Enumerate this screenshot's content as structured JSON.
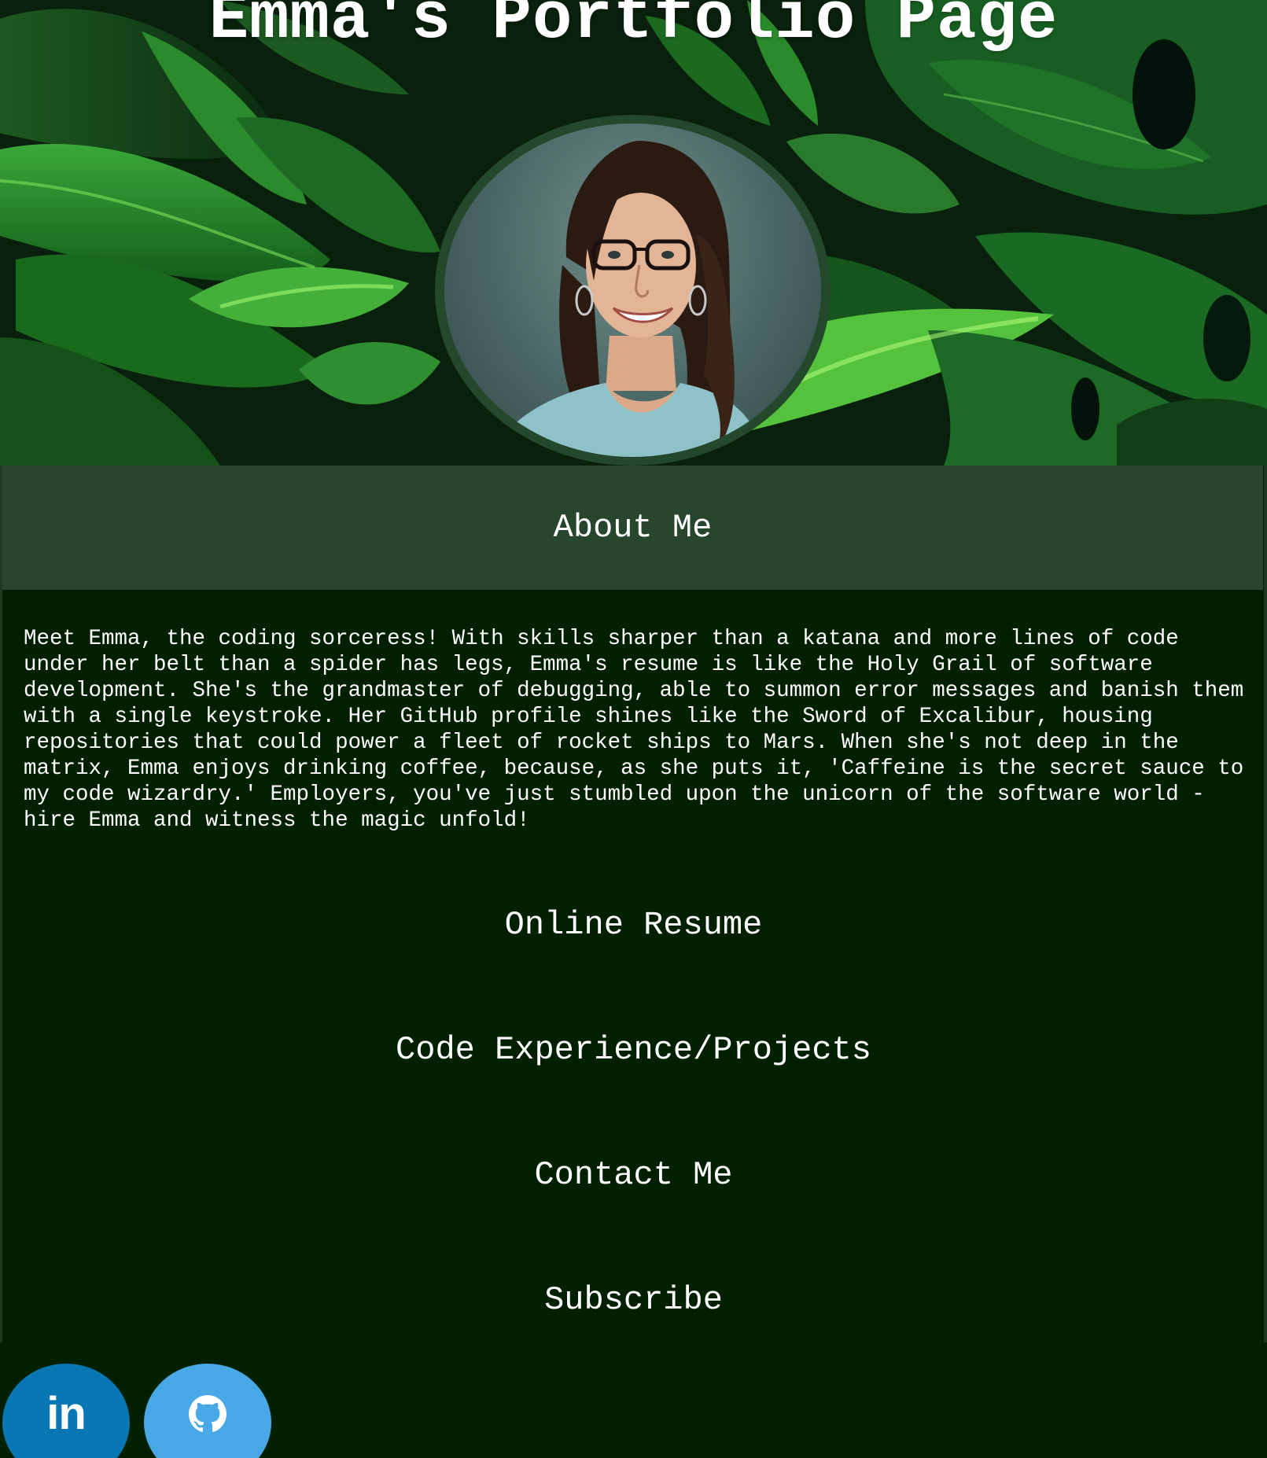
{
  "header": {
    "title": "Emma's Portfolio Page"
  },
  "about": {
    "heading": "About Me",
    "body": "Meet Emma, the coding sorceress! With skills sharper than a katana and more lines of code under her belt than a spider has legs, Emma's resume is like the Holy Grail of software development. She's the grandmaster of debugging, able to summon error messages and banish them with a single keystroke. Her GitHub profile shines like the Sword of Excalibur, housing repositories that could power a fleet of rocket ships to Mars. When she's not deep in the matrix, Emma enjoys drinking coffee, because, as she puts it, 'Caffeine is the secret sauce to my code wizardry.' Employers, you've just stumbled upon the unicorn of the software world - hire Emma and witness the magic unfold!"
  },
  "nav": {
    "items": [
      {
        "label": "Online Resume"
      },
      {
        "label": "Code Experience/Projects"
      },
      {
        "label": "Contact Me"
      },
      {
        "label": "Subscribe"
      }
    ]
  },
  "social": {
    "linkedin": {
      "label": "in",
      "icon": "linkedin-icon",
      "color": "#0a77b5"
    },
    "github": {
      "icon": "github-icon",
      "color": "#49a8e6"
    }
  },
  "colors": {
    "background": "#002000",
    "band": "#27462d",
    "ring": "#24482c"
  }
}
